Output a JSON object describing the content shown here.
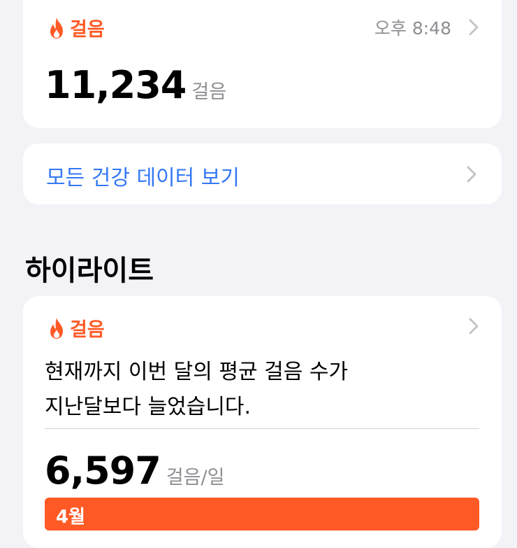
{
  "colors": {
    "accent": "#ff5a26",
    "link": "#3478f6",
    "secondary_text": "#8e8e93",
    "background": "#f2f2f7"
  },
  "steps_card": {
    "category": "걸음",
    "icon": "flame-icon",
    "time": "오후 8:48",
    "value": "11,234",
    "unit": "걸음"
  },
  "all_data_link": {
    "label": "모든 건강 데이터 보기"
  },
  "highlights": {
    "title": "하이라이트",
    "card": {
      "category": "걸음",
      "icon": "flame-icon",
      "text_line1": "현재까지 이번 달의 평균 걸음 수가",
      "text_line2": "지난달보다 늘었습니다.",
      "value": "6,597",
      "unit": "걸음/일",
      "bar_label": "4월"
    }
  }
}
